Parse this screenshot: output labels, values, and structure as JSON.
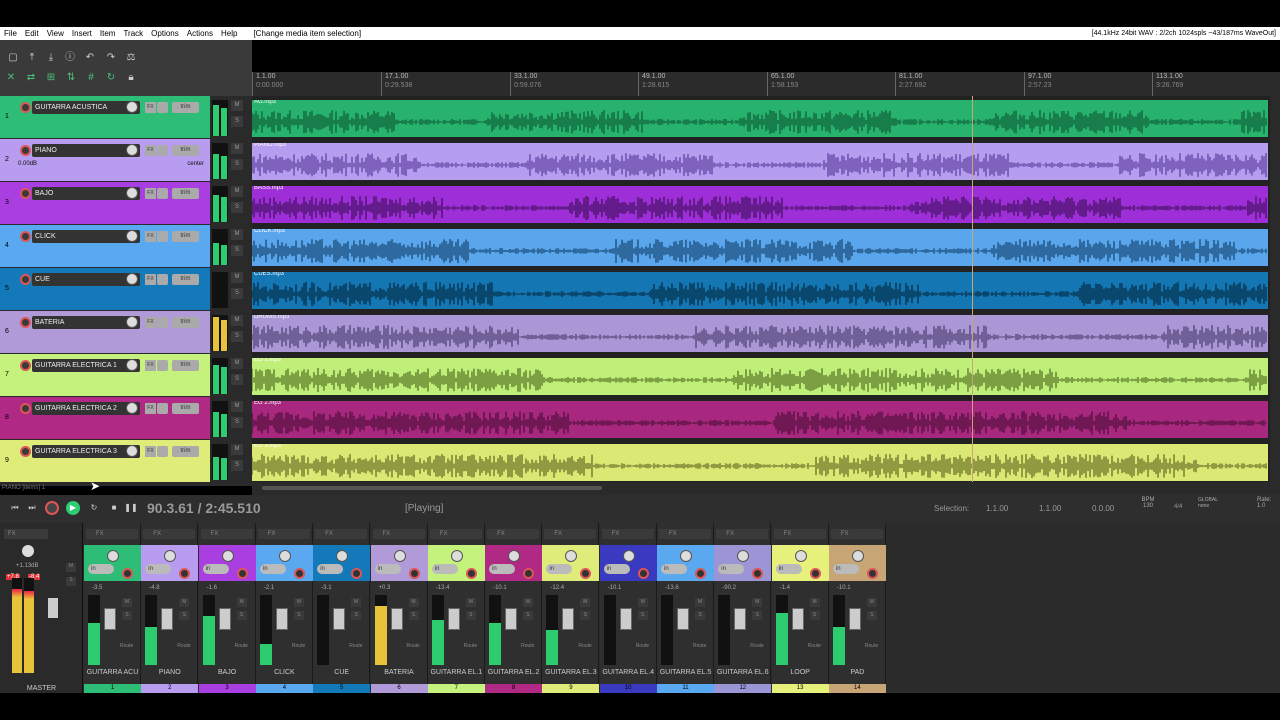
{
  "menu": {
    "items": [
      "File",
      "Edit",
      "View",
      "Insert",
      "Item",
      "Track",
      "Options",
      "Actions",
      "Help"
    ],
    "action_hint": "[Change media item selection]",
    "audio_status": "[44.1kHz 24bit WAV : 2/2ch 1024spls ~43/187ms WaveOut]"
  },
  "ruler": {
    "markers": [
      {
        "bar": "1.1.00",
        "time": "0:00.000"
      },
      {
        "bar": "17.1.00",
        "time": "0:29.538"
      },
      {
        "bar": "33.1.00",
        "time": "0:59.076"
      },
      {
        "bar": "49.1.00",
        "time": "1:28.615"
      },
      {
        "bar": "65.1.00",
        "time": "1:58.153"
      },
      {
        "bar": "81.1.00",
        "time": "2:27.692"
      },
      {
        "bar": "97.1.00",
        "time": "2:57.23"
      },
      {
        "bar": "113.1.00",
        "time": "3:26.769"
      }
    ]
  },
  "tracks": [
    {
      "num": "1",
      "name": "GUITARRA ACUSTICA",
      "color": "#2ebd77",
      "item": "AG.mp3",
      "itemColor": "#27b36d",
      "waveColor": "#0d5a35",
      "level": 0.85
    },
    {
      "num": "2",
      "name": "PIANO",
      "color": "#b79cf0",
      "item": "PIANO.mp3",
      "itemColor": "#b59ef0",
      "waveColor": "#5a3b9a",
      "level": 0.7,
      "vol": "0.00dB",
      "pan": "center"
    },
    {
      "num": "3",
      "name": "BAJO",
      "color": "#a93fe0",
      "item": "BASS.mp3",
      "itemColor": "#9d2ed8",
      "waveColor": "#3e0f5a",
      "level": 0.75
    },
    {
      "num": "4",
      "name": "CLICK",
      "color": "#5aa9f0",
      "item": "CLICK.mp3",
      "itemColor": "#5aa6ec",
      "waveColor": "#12416e",
      "level": 0.6
    },
    {
      "num": "5",
      "name": "CUE",
      "color": "#1479b8",
      "item": "CUES.mp3",
      "itemColor": "#1476b3",
      "waveColor": "#04283f",
      "level": 0.0
    },
    {
      "num": "6",
      "name": "BATERIA",
      "color": "#b09ad8",
      "item": "DRUMS.mp3",
      "itemColor": "#aa97d6",
      "waveColor": "#4a3c6e",
      "level": 0.95
    },
    {
      "num": "7",
      "name": "GUITARRA ELECTRICA 1",
      "color": "#c4f27d",
      "item": "EG 1.mp3",
      "itemColor": "#c0ef79",
      "waveColor": "#4d6b1f",
      "level": 0.8
    },
    {
      "num": "8",
      "name": "GUITARRA ELECTRICA 2",
      "color": "#b02a85",
      "item": "EG 2.mp3",
      "itemColor": "#a8277f",
      "waveColor": "#4a0f36",
      "level": 0.7
    },
    {
      "num": "9",
      "name": "GUITARRA ELECTRICA 3",
      "color": "#e0ec7a",
      "item": "EG 3.mp3",
      "itemColor": "#dbe874",
      "waveColor": "#5f6620",
      "level": 0.65
    }
  ],
  "transport": {
    "position": "90.3.61 / 2:45.510",
    "state": "[Playing]",
    "selection_label": "Selection:",
    "sel_start": "1.1.00",
    "sel_end": "1.1.00",
    "sel_len": "0.0.00",
    "bpm_label": "BPM",
    "bpm": "130",
    "timesig": "4/4",
    "global_label": "GLOBAL",
    "global_val": "none",
    "rate_label": "Rate:",
    "rate": "1.0"
  },
  "status_line": "PIANO [items] 1",
  "mixer": {
    "master_label": "MASTER",
    "master_db": "+1.13dB",
    "master_peak_l": "+7.8",
    "master_peak_r": "-8.4",
    "strips": [
      {
        "name": "GUITARRA ACU",
        "num": "1",
        "color": "#2ebd77",
        "db": "-3.5",
        "level": 0.6
      },
      {
        "name": "PIANO",
        "num": "2",
        "color": "#b79cf0",
        "db": "-4.8",
        "level": 0.55
      },
      {
        "name": "BAJO",
        "num": "3",
        "color": "#a93fe0",
        "db": "-1.6",
        "level": 0.7
      },
      {
        "name": "CLICK",
        "num": "4",
        "color": "#5aa9f0",
        "db": "-2.1",
        "level": 0.3
      },
      {
        "name": "CUE",
        "num": "5",
        "color": "#1479b8",
        "db": "-3.1",
        "level": 0.0
      },
      {
        "name": "BATERIA",
        "num": "6",
        "color": "#b09ad8",
        "db": "+0.3",
        "level": 0.85
      },
      {
        "name": "GUITARRA EL.1",
        "num": "7",
        "color": "#c4f27d",
        "db": "-13.4",
        "level": 0.65
      },
      {
        "name": "GUITARRA EL.2",
        "num": "8",
        "color": "#b02a85",
        "db": "-10.1",
        "level": 0.6
      },
      {
        "name": "GUITARRA EL.3",
        "num": "9",
        "color": "#e0ec7a",
        "db": "-12.4",
        "level": 0.5
      },
      {
        "name": "GUITARRA EL.4",
        "num": "10",
        "color": "#3a3ac0",
        "db": "-10.1",
        "level": 0.0
      },
      {
        "name": "GUITARRA EL.5",
        "num": "11",
        "color": "#5aa9f0",
        "db": "-13.6",
        "level": 0.0
      },
      {
        "name": "GUITARRA EL.6",
        "num": "12",
        "color": "#9b95d6",
        "db": "-90.2",
        "level": 0.0
      },
      {
        "name": "LOOP",
        "num": "13",
        "color": "#e6f07a",
        "db": "-1.4",
        "level": 0.75
      },
      {
        "name": "PAD",
        "num": "14",
        "color": "#c7a574",
        "db": "-10.1",
        "level": 0.55
      }
    ]
  }
}
